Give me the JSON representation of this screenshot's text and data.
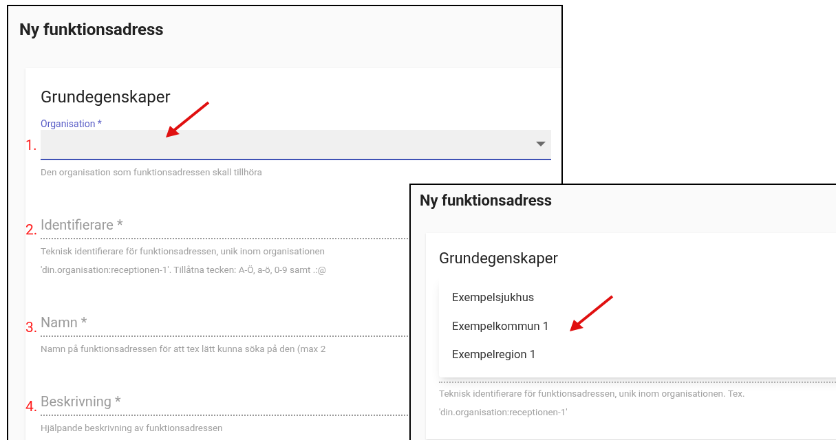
{
  "screenshots": [
    {
      "title": "Ny funktionsadress",
      "heading": "Grundegenskaper",
      "fields": [
        {
          "kind": "select",
          "number": "1.",
          "label": "Organisation *",
          "helper": [
            "Den organisation som funktionsadressen skall tillhöra"
          ]
        },
        {
          "kind": "text",
          "number": "2.",
          "label": "Identifierare *",
          "helper": [
            "Teknisk identifierare för funktionsadressen, unik inom organisationen",
            "'din.organisation:receptionen-1'. Tillåtna tecken: A-Ö, a-ö, 0-9 samt .:@"
          ]
        },
        {
          "kind": "text",
          "number": "3.",
          "label": "Namn *",
          "helper": [
            "Namn på funktionsadressen för att tex lätt kunna söka på den (max 2"
          ]
        },
        {
          "kind": "text",
          "number": "4.",
          "label": "Beskrivning *",
          "helper": [
            "Hjälpande beskrivning av funktionsadressen"
          ]
        }
      ]
    },
    {
      "title": "Ny funktionsadress",
      "heading": "Grundegenskaper",
      "menu": [
        "Exempelsjukhus",
        "Exempelkommun 1",
        "Exempelregion 1"
      ],
      "fields": [
        {
          "kind": "text",
          "helper": [
            "Teknisk identifierare för funktionsadressen, unik inom organisationen. Tex.",
            "'din.organisation:receptionen-1'"
          ]
        }
      ]
    }
  ]
}
